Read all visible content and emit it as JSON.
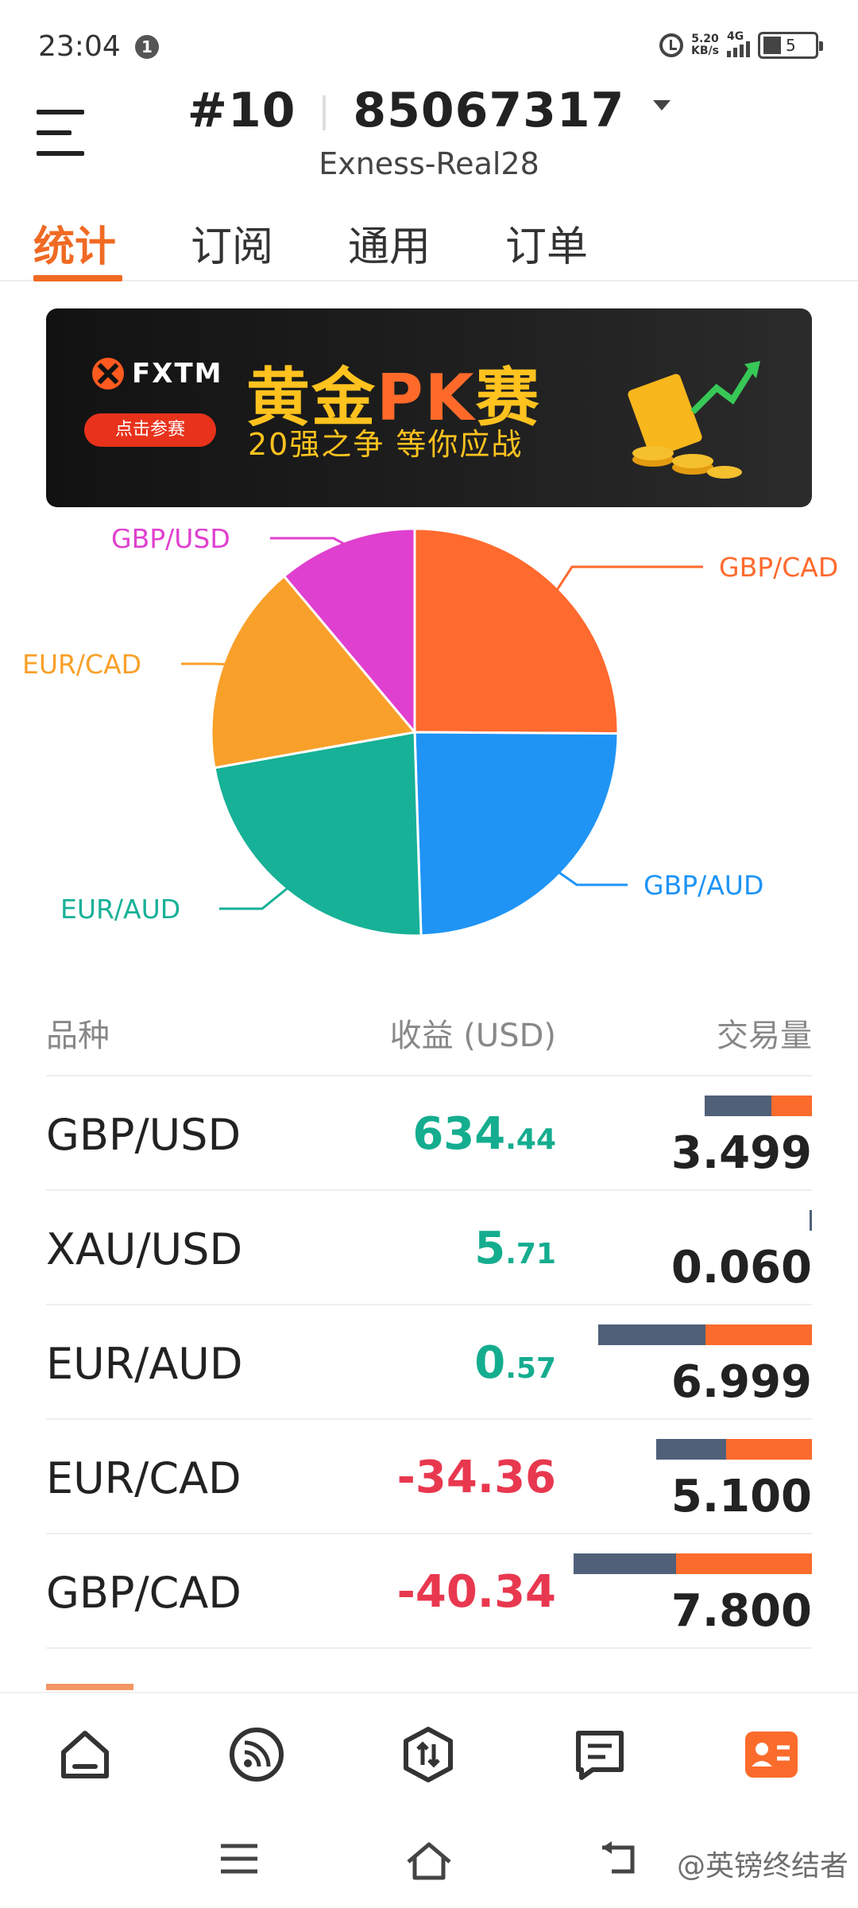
{
  "status_bar": {
    "time": "23:04",
    "notification_count": "1",
    "net_speed_value": "5.20",
    "net_speed_unit": "KB/s",
    "network_type": "4G",
    "battery": "5"
  },
  "header": {
    "account_prefix": "#10",
    "account_number": "85067317",
    "server": "Exness-Real28"
  },
  "tabs": [
    {
      "label": "统计",
      "active": true
    },
    {
      "label": "订阅",
      "active": false
    },
    {
      "label": "通用",
      "active": false
    },
    {
      "label": "订单",
      "active": false
    }
  ],
  "banner": {
    "brand": "FXTM",
    "button": "点击参赛",
    "headline_a": "黄金",
    "headline_b": "PK",
    "headline_c": "赛",
    "subtitle": "20强之争  等你应战"
  },
  "chart_data": {
    "type": "pie",
    "slices": [
      {
        "label": "GBP/CAD",
        "value": 25.1,
        "color": "#ff6a2e"
      },
      {
        "label": "GBP/AUD",
        "value": 24.4,
        "color": "#1f94f5"
      },
      {
        "label": "EUR/AUD",
        "value": 22.7,
        "color": "#17b197"
      },
      {
        "label": "EUR/CAD",
        "value": 16.7,
        "color": "#f9a02a"
      },
      {
        "label": "GBP/USD",
        "value": 11.1,
        "color": "#e040cf"
      }
    ]
  },
  "table": {
    "headers": {
      "symbol": "品种",
      "profit": "收益 (USD)",
      "volume": "交易量"
    },
    "rows": [
      {
        "symbol": "GBP/USD",
        "profit_int": "634",
        "profit_dec": ".44",
        "sign": "pos",
        "volume": "3.499",
        "buy_share": 0.62,
        "bar_total": 0.449
      },
      {
        "symbol": "XAU/USD",
        "profit_int": "5",
        "profit_dec": ".71",
        "sign": "pos",
        "volume": "0.060",
        "buy_share": 1.0,
        "bar_total": 0.008
      },
      {
        "symbol": "EUR/AUD",
        "profit_int": "0",
        "profit_dec": ".57",
        "sign": "pos",
        "volume": "6.999",
        "buy_share": 0.5,
        "bar_total": 0.897
      },
      {
        "symbol": "EUR/CAD",
        "profit_int": "-34.36",
        "profit_dec": "",
        "sign": "neg",
        "volume": "5.100",
        "buy_share": 0.45,
        "bar_total": 0.654
      },
      {
        "symbol": "GBP/CAD",
        "profit_int": "-40.34",
        "profit_dec": "",
        "sign": "neg",
        "volume": "7.800",
        "buy_share": 0.43,
        "bar_total": 1.0
      }
    ]
  },
  "bottom_nav": [
    "home-icon",
    "signal-feed-icon",
    "trade-icon",
    "messages-icon",
    "profile-card-icon"
  ],
  "watermark": "@英镑终结者"
}
